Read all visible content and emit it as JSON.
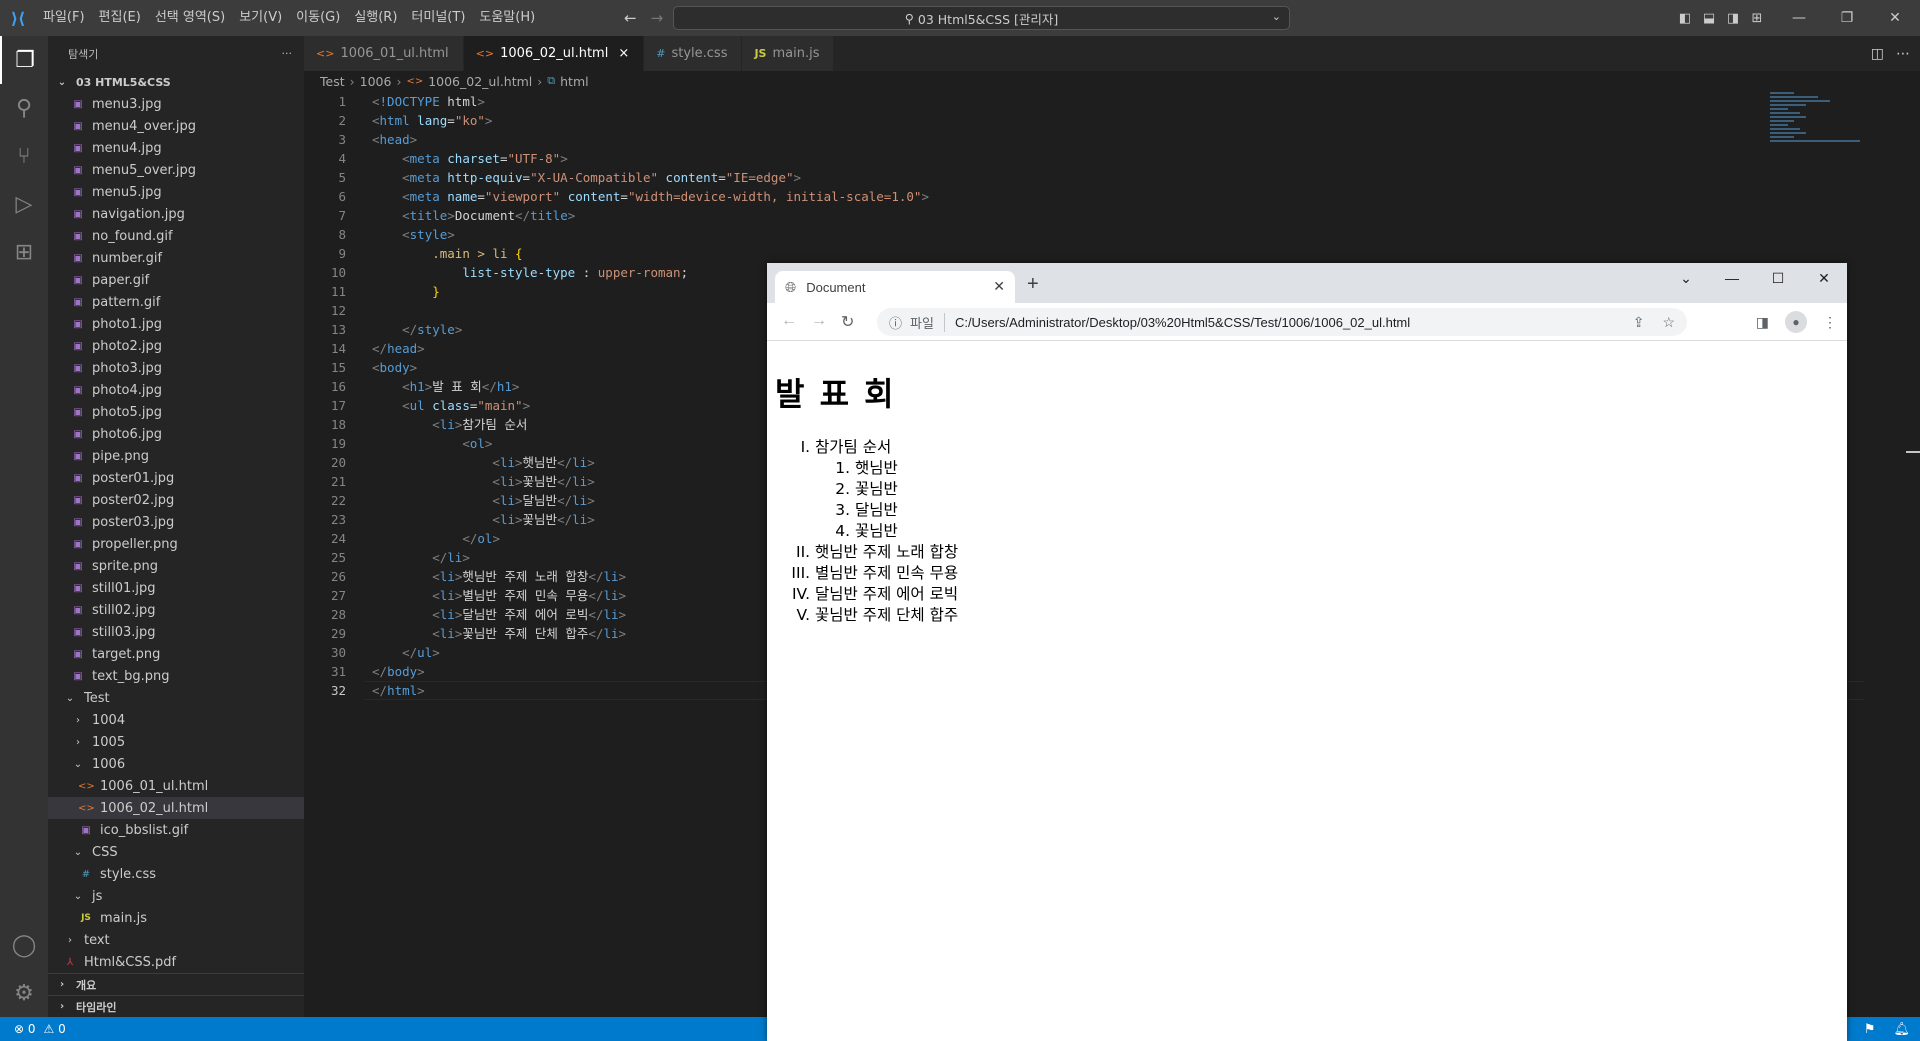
{
  "titlebar": {
    "menu": [
      "파일(F)",
      "편집(E)",
      "선택 영역(S)",
      "보기(V)",
      "이동(G)",
      "실행(R)",
      "터미널(T)",
      "도움말(H)"
    ],
    "command_center": "03 Html5&CSS [관리자]"
  },
  "sidebar": {
    "header": "탐색기",
    "more": "···",
    "root": "03 HTML5&CSS",
    "files": [
      "menu3.jpg",
      "menu4_over.jpg",
      "menu4.jpg",
      "menu5_over.jpg",
      "menu5.jpg",
      "navigation.jpg",
      "no_found.gif",
      "number.gif",
      "paper.gif",
      "pattern.gif",
      "photo1.jpg",
      "photo2.jpg",
      "photo3.jpg",
      "photo4.jpg",
      "photo5.jpg",
      "photo6.jpg",
      "pipe.png",
      "poster01.jpg",
      "poster02.jpg",
      "poster03.jpg",
      "propeller.png",
      "sprite.png",
      "still01.jpg",
      "still02.jpg",
      "still03.jpg",
      "target.png",
      "text_bg.png"
    ],
    "test_folder": "Test",
    "folder_1004": "1004",
    "folder_1005": "1005",
    "folder_1006": "1006",
    "file_1006_01": "1006_01_ul.html",
    "file_1006_02": "1006_02_ul.html",
    "file_ico": "ico_bbslist.gif",
    "folder_css": "CSS",
    "file_style": "style.css",
    "folder_js": "js",
    "file_main": "main.js",
    "folder_text": "text",
    "file_pdf": "Html&CSS.pdf",
    "outline": "개요",
    "timeline": "타임라인"
  },
  "tabs": [
    {
      "label": "1006_01_ul.html",
      "icon": "html-icon"
    },
    {
      "label": "1006_02_ul.html",
      "icon": "html-icon",
      "close": "×"
    },
    {
      "label": "style.css",
      "icon": "css-icon"
    },
    {
      "label": "main.js",
      "icon": "js-icon"
    }
  ],
  "breadcrumb": {
    "p1": "Test",
    "p2": "1006",
    "p3": "1006_02_ul.html",
    "p4": "html"
  },
  "code": {
    "current_line": 32,
    "lines": [
      "<!DOCTYPE html>",
      "<html lang=\"ko\">",
      "<head>",
      "    <meta charset=\"UTF-8\">",
      "    <meta http-equiv=\"X-UA-Compatible\" content=\"IE=edge\">",
      "    <meta name=\"viewport\" content=\"width=device-width, initial-scale=1.0\">",
      "    <title>Document</title>",
      "    <style>",
      "        .main > li {",
      "            list-style-type : upper-roman;",
      "        }",
      "",
      "    </style>",
      "</head>",
      "<body>",
      "    <h1>발 표 회</h1>",
      "    <ul class=\"main\">",
      "        <li>참가팀 순서",
      "            <ol>",
      "                <li>햇님반</li>",
      "                <li>꽃님반</li>",
      "                <li>달님반</li>",
      "                <li>꽃님반</li>",
      "            </ol>",
      "        </li>",
      "        <li>햇님반 주제 노래 합창</li>",
      "        <li>별님반 주제 민속 무용</li>",
      "        <li>달님반 주제 에어 로빅</li>",
      "        <li>꽃님반 주제 단체 합주</li>",
      "    </ul>",
      "</body>",
      "</html>"
    ]
  },
  "statusbar": {
    "errors": "⊗ 0",
    "warnings": "⚠ 0"
  },
  "browser": {
    "tab_title": "Document",
    "new_tab": "+",
    "scheme_label": "파일",
    "url": "C:/Users/Administrator/Desktop/03%20Html5&CSS/Test/1006/1006_02_ul.html",
    "page": {
      "heading": "발 표 회",
      "item1": "참가팀 순서",
      "sub_items": [
        "햇님반",
        "꽃님반",
        "달님반",
        "꽃님반"
      ],
      "item2": "햇님반 주제 노래 합창",
      "item3": "별님반 주제 민속 무용",
      "item4": "달님반 주제 에어 로빅",
      "item5": "꽃님반 주제 단체 합주"
    }
  }
}
